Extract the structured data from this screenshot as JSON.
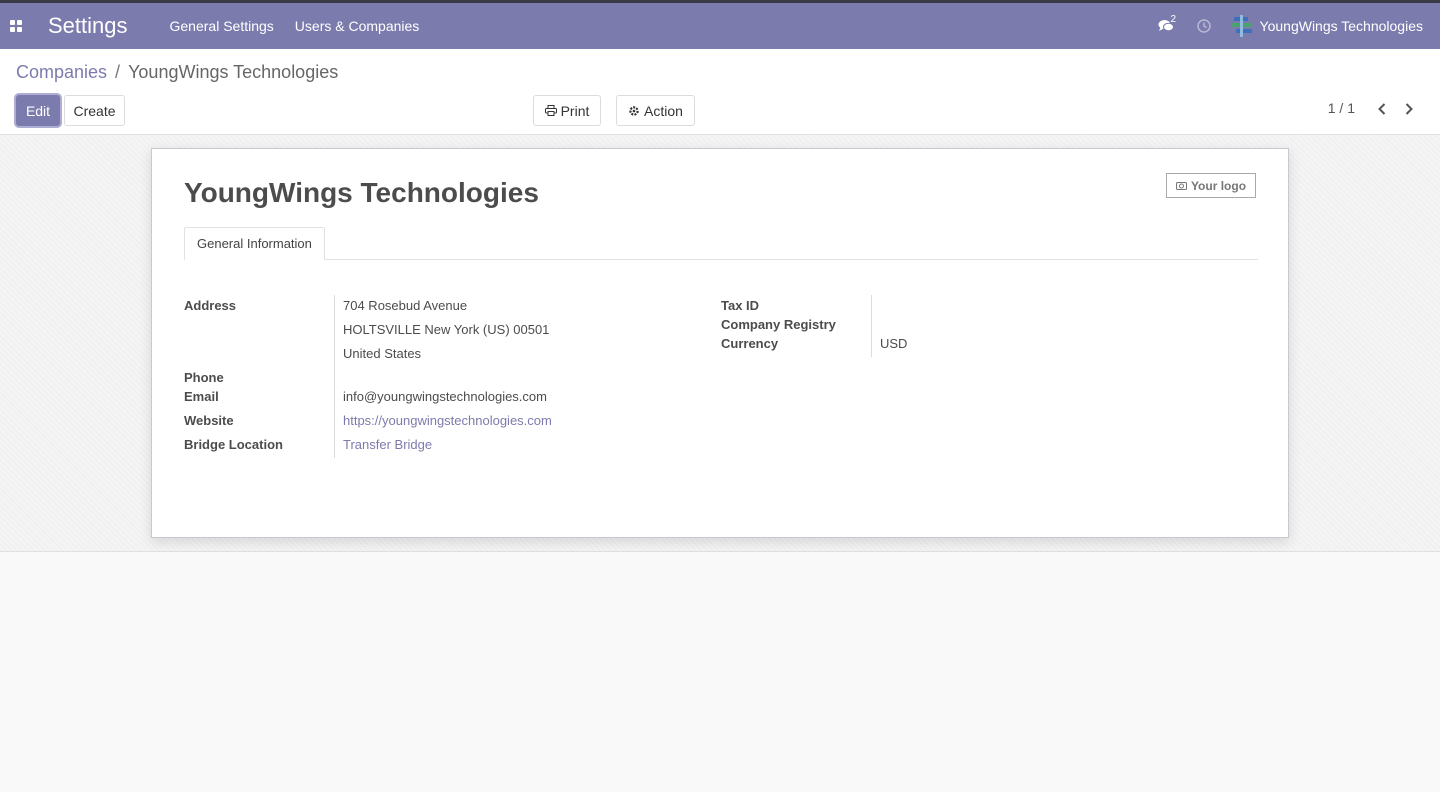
{
  "topbar": {
    "app_title": "Settings",
    "menu": [
      "General Settings",
      "Users & Companies"
    ],
    "messages_count": "2",
    "company_name": "YoungWings Technologies",
    "accent_color": "#7c7bad"
  },
  "breadcrumb": {
    "parent": "Companies",
    "separator": "/",
    "current": "YoungWings Technologies"
  },
  "toolbar": {
    "edit_label": "Edit",
    "create_label": "Create",
    "print_label": "Print",
    "action_label": "Action",
    "pager": "1 / 1"
  },
  "form": {
    "title": "YoungWings Technologies",
    "logo_label": "Your logo",
    "tab_label": "General Information",
    "labels": {
      "address": "Address",
      "phone": "Phone",
      "email": "Email",
      "website": "Website",
      "bridge_location": "Bridge Location",
      "tax_id": "Tax ID",
      "company_registry": "Company Registry",
      "currency": "Currency"
    },
    "values": {
      "street": "704 Rosebud Avenue",
      "city_line": "HOLTSVILLE  New York (US)  00501",
      "country": "United States",
      "phone": "",
      "email": "info@youngwingstechnologies.com",
      "website": "https://youngwingstechnologies.com",
      "bridge_location": "Transfer Bridge",
      "tax_id": "",
      "company_registry": "",
      "currency": "USD"
    }
  },
  "icons": [
    "apps-icon",
    "chat-icon",
    "clock-icon",
    "company-logo-icon",
    "print-icon",
    "gear-icon",
    "chevron-left-icon",
    "chevron-right-icon",
    "camera-icon"
  ]
}
